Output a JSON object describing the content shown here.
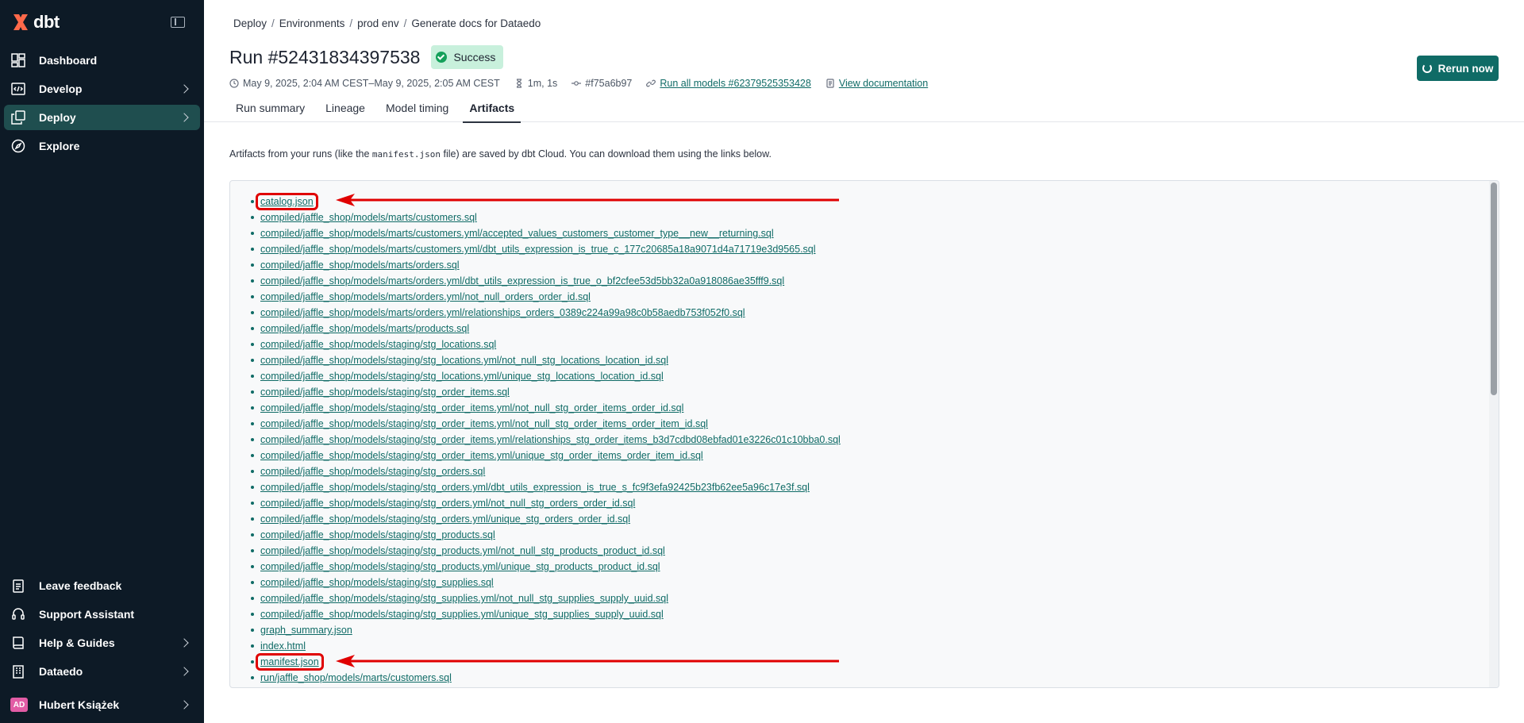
{
  "sidebar": {
    "brand": "dbt",
    "items": [
      {
        "label": "Dashboard",
        "icon": "dashboard-icon"
      },
      {
        "label": "Develop",
        "icon": "code-icon"
      },
      {
        "label": "Deploy",
        "icon": "deploy-icon"
      },
      {
        "label": "Explore",
        "icon": "compass-icon"
      }
    ],
    "bottom_items": [
      {
        "label": "Leave feedback",
        "icon": "clipboard-icon"
      },
      {
        "label": "Support Assistant",
        "icon": "headset-icon"
      },
      {
        "label": "Help & Guides",
        "icon": "book-icon"
      },
      {
        "label": "Dataedo",
        "icon": "building-icon"
      }
    ],
    "user": {
      "initials": "AD",
      "name": "Hubert Książek"
    }
  },
  "breadcrumb": [
    "Deploy",
    "Environments",
    "prod env",
    "Generate docs for Dataedo"
  ],
  "run": {
    "title": "Run #52431834397538",
    "status": "Success",
    "time_range": "May 9, 2025, 2:04 AM CEST–May 9, 2025, 2:05 AM CEST",
    "duration": "1m, 1s",
    "commit": "#f75a6b97",
    "job_link": "Run all models #62379525353428",
    "docs_link": "View documentation",
    "rerun_label": "Rerun now"
  },
  "tabs": [
    "Run summary",
    "Lineage",
    "Model timing",
    "Artifacts"
  ],
  "intro": {
    "before": "Artifacts from your runs (like the ",
    "code": "manifest.json",
    "after": " file) are saved by dbt Cloud. You can download them using the links below."
  },
  "artifacts": [
    "catalog.json",
    "compiled/jaffle_shop/models/marts/customers.sql",
    "compiled/jaffle_shop/models/marts/customers.yml/accepted_values_customers_customer_type__new__returning.sql",
    "compiled/jaffle_shop/models/marts/customers.yml/dbt_utils_expression_is_true_c_177c20685a18a9071d4a71719e3d9565.sql",
    "compiled/jaffle_shop/models/marts/orders.sql",
    "compiled/jaffle_shop/models/marts/orders.yml/dbt_utils_expression_is_true_o_bf2cfee53d5bb32a0a918086ae35fff9.sql",
    "compiled/jaffle_shop/models/marts/orders.yml/not_null_orders_order_id.sql",
    "compiled/jaffle_shop/models/marts/orders.yml/relationships_orders_0389c224a99a98c0b58aedb753f052f0.sql",
    "compiled/jaffle_shop/models/marts/products.sql",
    "compiled/jaffle_shop/models/staging/stg_locations.sql",
    "compiled/jaffle_shop/models/staging/stg_locations.yml/not_null_stg_locations_location_id.sql",
    "compiled/jaffle_shop/models/staging/stg_locations.yml/unique_stg_locations_location_id.sql",
    "compiled/jaffle_shop/models/staging/stg_order_items.sql",
    "compiled/jaffle_shop/models/staging/stg_order_items.yml/not_null_stg_order_items_order_id.sql",
    "compiled/jaffle_shop/models/staging/stg_order_items.yml/not_null_stg_order_items_order_item_id.sql",
    "compiled/jaffle_shop/models/staging/stg_order_items.yml/relationships_stg_order_items_b3d7cdbd08ebfad01e3226c01c10bba0.sql",
    "compiled/jaffle_shop/models/staging/stg_order_items.yml/unique_stg_order_items_order_item_id.sql",
    "compiled/jaffle_shop/models/staging/stg_orders.sql",
    "compiled/jaffle_shop/models/staging/stg_orders.yml/dbt_utils_expression_is_true_s_fc9f3efa92425b23fb62ee5a96c17e3f.sql",
    "compiled/jaffle_shop/models/staging/stg_orders.yml/not_null_stg_orders_order_id.sql",
    "compiled/jaffle_shop/models/staging/stg_orders.yml/unique_stg_orders_order_id.sql",
    "compiled/jaffle_shop/models/staging/stg_products.sql",
    "compiled/jaffle_shop/models/staging/stg_products.yml/not_null_stg_products_product_id.sql",
    "compiled/jaffle_shop/models/staging/stg_products.yml/unique_stg_products_product_id.sql",
    "compiled/jaffle_shop/models/staging/stg_supplies.sql",
    "compiled/jaffle_shop/models/staging/stg_supplies.yml/not_null_stg_supplies_supply_uuid.sql",
    "compiled/jaffle_shop/models/staging/stg_supplies.yml/unique_stg_supplies_supply_uuid.sql",
    "graph_summary.json",
    "index.html",
    "manifest.json",
    "run/jaffle_shop/models/marts/customers.sql"
  ],
  "highlighted_artifacts": [
    "catalog.json",
    "manifest.json"
  ],
  "colors": {
    "sidebar_bg": "#0d1a26",
    "accent": "#0f6b66",
    "success": "#14a05a",
    "highlight": "#e00000"
  }
}
